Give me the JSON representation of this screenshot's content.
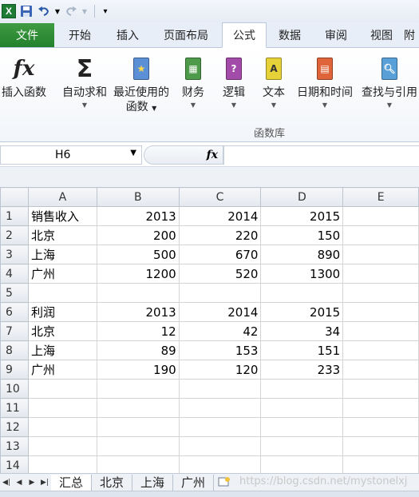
{
  "qat": {
    "excel_icon": "excel-logo",
    "save_icon": "save-icon",
    "undo_icon": "undo-icon",
    "redo_icon": "redo-icon",
    "customize_icon": "customize-icon"
  },
  "ribbon_tabs": [
    "文件",
    "开始",
    "插入",
    "页面布局",
    "公式",
    "数据",
    "审阅",
    "视图",
    "附"
  ],
  "active_tab": "公式",
  "ribbon": {
    "insert_function": "插入函数",
    "autosum": "自动求和",
    "recent_line1": "最近使用的",
    "recent_line2": "函数",
    "financial": "财务",
    "logical": "逻辑",
    "text": "文本",
    "datetime": "日期和时间",
    "lookup": "查找与引用",
    "group_label": "函数库",
    "fx_glyph": "fx",
    "sigma_glyph": "Σ",
    "logical_glyph": "?",
    "text_glyph": "A"
  },
  "formula_bar": {
    "name_box": "H6",
    "fx_label": "fx",
    "formula": ""
  },
  "columns": [
    "A",
    "B",
    "C",
    "D",
    "E"
  ],
  "rows": [
    [
      "1",
      "销售收入",
      "2013",
      "2014",
      "2015",
      ""
    ],
    [
      "2",
      "北京",
      "200",
      "220",
      "150",
      ""
    ],
    [
      "3",
      "上海",
      "500",
      "670",
      "890",
      ""
    ],
    [
      "4",
      "广州",
      "1200",
      "520",
      "1300",
      ""
    ],
    [
      "5",
      "",
      "",
      "",
      "",
      ""
    ],
    [
      "6",
      "利润",
      "2013",
      "2014",
      "2015",
      ""
    ],
    [
      "7",
      "北京",
      "12",
      "42",
      "34",
      ""
    ],
    [
      "8",
      "上海",
      "89",
      "153",
      "151",
      ""
    ],
    [
      "9",
      "广州",
      "190",
      "120",
      "233",
      ""
    ],
    [
      "10",
      "",
      "",
      "",
      "",
      ""
    ],
    [
      "11",
      "",
      "",
      "",
      "",
      ""
    ],
    [
      "12",
      "",
      "",
      "",
      "",
      ""
    ],
    [
      "13",
      "",
      "",
      "",
      "",
      ""
    ],
    [
      "14",
      "",
      "",
      "",
      "",
      ""
    ]
  ],
  "sheets": [
    "汇总",
    "北京",
    "上海",
    "广州"
  ],
  "active_sheet": "汇总",
  "watermark": "https://blog.csdn.net/mystonelxj",
  "colors": {
    "file_tab": "#2e8b36",
    "ribbon_bg": "#f2f5fa",
    "grid_line": "#d4d4d4"
  }
}
